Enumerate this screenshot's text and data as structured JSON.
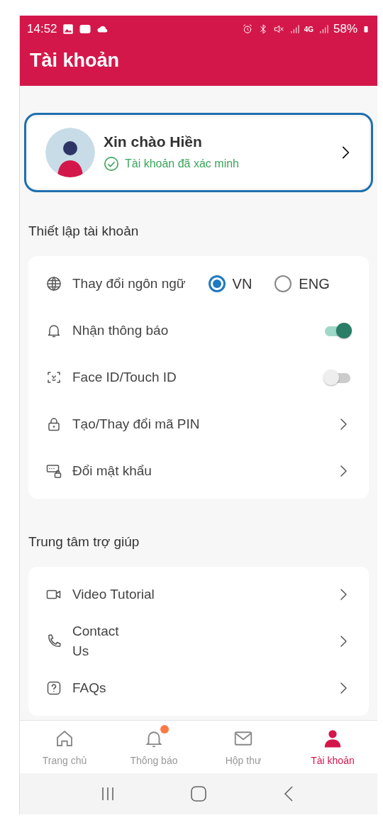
{
  "status_bar": {
    "time": "14:52",
    "network": "4G",
    "battery": "58%"
  },
  "header": {
    "title": "Tài khoản"
  },
  "profile": {
    "greeting": "Xin chào Hiền",
    "status": "Tài khoản đã xác minh",
    "verified": true,
    "highlighted": true
  },
  "sections": [
    {
      "title": "Thiết lập tài khoản",
      "items": [
        {
          "kind": "radio",
          "label": "Thay đổi ngôn ngữ",
          "options": [
            {
              "label": "VN",
              "selected": true
            },
            {
              "label": "ENG",
              "selected": false
            }
          ]
        },
        {
          "kind": "toggle",
          "label": "Nhận thông báo",
          "on": true
        },
        {
          "kind": "toggle",
          "label": "Face ID/Touch ID",
          "on": false
        },
        {
          "kind": "link",
          "label": "Tạo/Thay đổi mã PIN"
        },
        {
          "kind": "link",
          "label": "Đổi mật khẩu"
        }
      ]
    },
    {
      "title": "Trung tâm trợ giúp",
      "items": [
        {
          "kind": "link",
          "label": "Video Tutorial"
        },
        {
          "kind": "link",
          "label": "Contact\nUs"
        },
        {
          "kind": "link",
          "label": "FAQs"
        }
      ]
    }
  ],
  "bottom_nav": [
    {
      "label": "Trang chủ",
      "selected": false,
      "badge": false
    },
    {
      "label": "Thông báo",
      "selected": false,
      "badge": true
    },
    {
      "label": "Hộp thư",
      "selected": false,
      "badge": false
    },
    {
      "label": "Tài khoản",
      "selected": true,
      "badge": false
    }
  ]
}
